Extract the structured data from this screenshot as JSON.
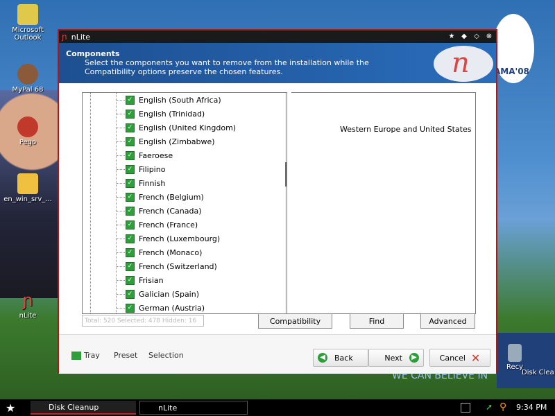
{
  "desktop": {
    "icons": [
      {
        "label": "Microsoft Outlook",
        "color": "#e0c84a"
      },
      {
        "label": "MyPal 68",
        "color": "#8a5a3a"
      },
      {
        "label": "Pego",
        "color": "#c0392b"
      },
      {
        "label": "en_win_srv_...",
        "color": "#f0c040"
      },
      {
        "label": "nLite",
        "color": "#d44"
      }
    ],
    "right_icons": [
      {
        "label": "Recy"
      },
      {
        "label": "Disk Clea"
      }
    ],
    "logo_text": "AMA'08",
    "banner_text": "WE CAN BELIEVE IN"
  },
  "window": {
    "title": "nLite",
    "header_title": "Components",
    "header_description": "Select the components you want to remove from the installation while the Compatibility options preserve the chosen features.",
    "tree_items": [
      "English (South Africa)",
      "English (Trinidad)",
      "English (United Kingdom)",
      "English (Zimbabwe)",
      "Faeroese",
      "Filipino",
      "Finnish",
      "French (Belgium)",
      "French (Canada)",
      "French (France)",
      "French (Luxembourg)",
      "French (Monaco)",
      "French (Switzerland)",
      "Frisian",
      "Galician (Spain)",
      "German (Austria)"
    ],
    "details_text": "Western Europe and United States",
    "status_text": "Total: 520 Selected: 478 Hidden: 16",
    "tabs": {
      "compatibility": "Compatibility",
      "find": "Find",
      "advanced": "Advanced"
    },
    "footer": {
      "tray": "Tray",
      "preset": "Preset",
      "selection": "Selection",
      "back": "Back",
      "next": "Next",
      "cancel": "Cancel"
    }
  },
  "taskbar": {
    "item1": "Disk Cleanup",
    "item2": "nLite",
    "clock": "9:34 PM"
  },
  "colors": {
    "accent": "#2a6dbb",
    "checkbox": "#2d9e3a",
    "border": "#b01818"
  }
}
